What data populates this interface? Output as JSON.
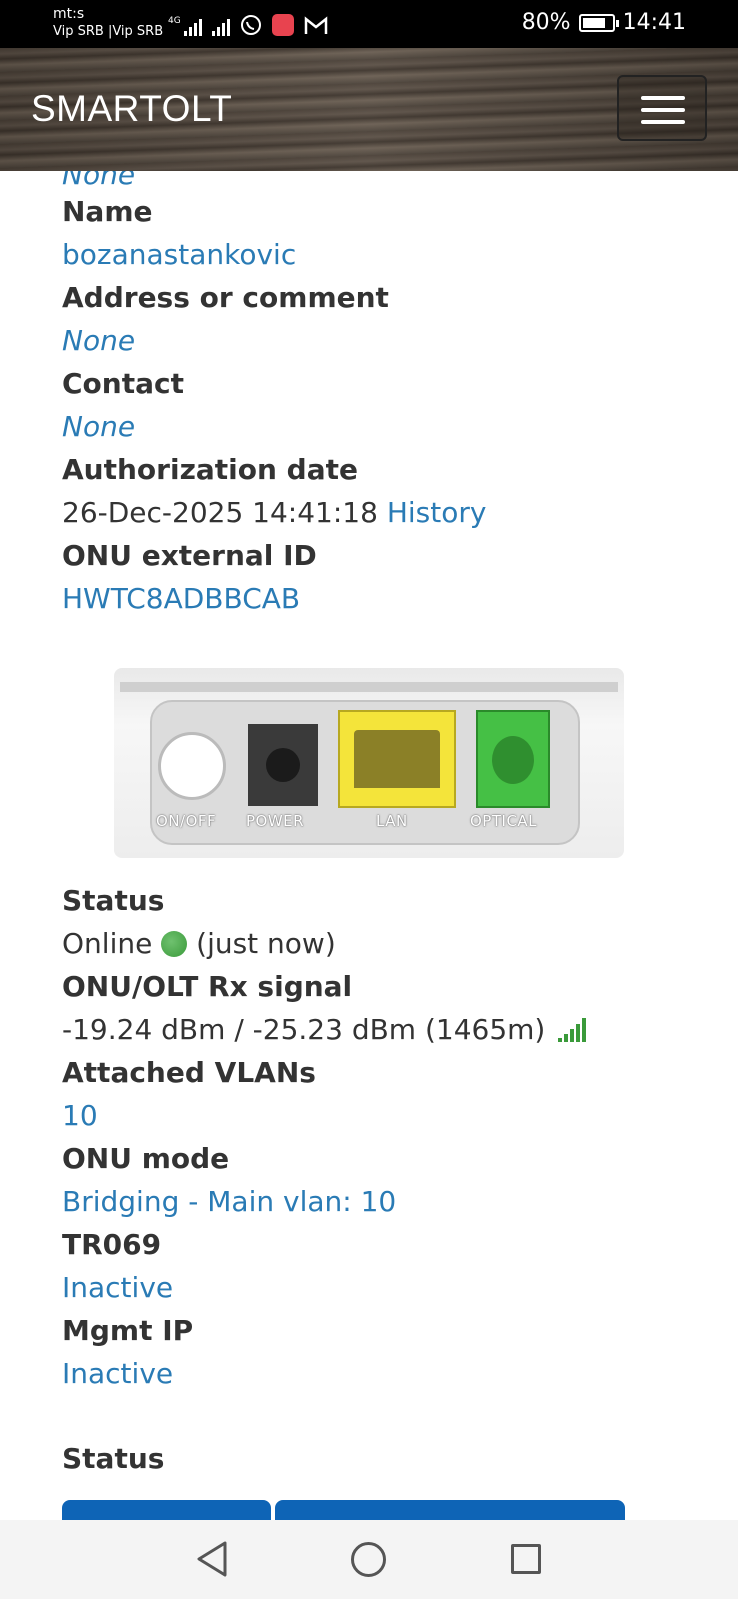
{
  "status_bar": {
    "carrier_line1": "mt:s",
    "carrier_line2": "Vip SRB |Vip SRB",
    "network": "4G",
    "battery": "80%",
    "battery_level": 0.8,
    "time": "14:41"
  },
  "navbar": {
    "brand": "SMARTOLT",
    "menu_icon": "hamburger-icon"
  },
  "details": {
    "cut_value": "None",
    "name_label": "Name",
    "name_value": "bozanastankovic",
    "address_label": "Address or comment",
    "address_value": "None",
    "contact_label": "Contact",
    "contact_value": "None",
    "auth_label": "Authorization date",
    "auth_value": "26-Dec-2025 14:41:18",
    "history_link": "History",
    "external_id_label": "ONU external ID",
    "external_id_value": "HWTC8ADBBCAB"
  },
  "onu_image": {
    "ports": [
      "ON/OFF",
      "POWER",
      "LAN",
      "OPTICAL"
    ]
  },
  "status_section": {
    "status_label": "Status",
    "status_value": "Online",
    "status_time": "(just now)",
    "rx_label": "ONU/OLT Rx signal",
    "rx_value": "-19.24 dBm / -25.23 dBm (1465m)",
    "vlans_label": "Attached VLANs",
    "vlans_value": "10",
    "mode_label": "ONU mode",
    "mode_value": "Bridging - Main vlan: 10",
    "tr069_label": "TR069",
    "tr069_value": "Inactive",
    "mgmt_label": "Mgmt IP",
    "mgmt_value": "Inactive",
    "status2_label": "Status"
  },
  "colors": {
    "link": "#2a7bb5",
    "button": "#0e64b6",
    "online": "#3a9a3a"
  }
}
